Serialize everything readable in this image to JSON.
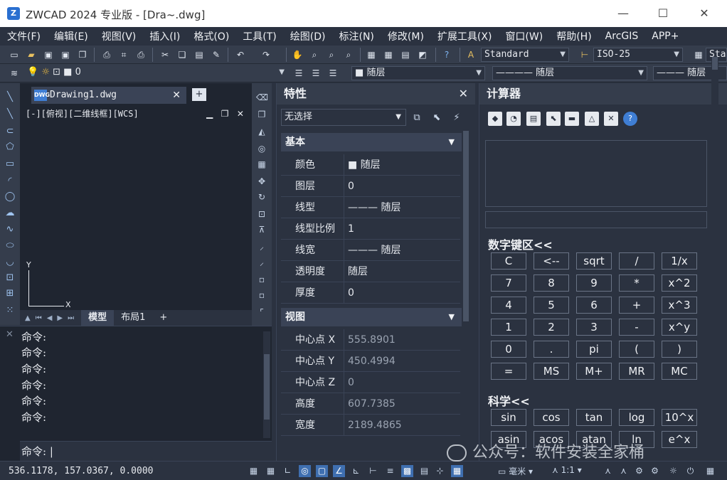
{
  "window": {
    "title": "ZWCAD 2024 专业版 - [Dra~.dwg]",
    "minimize": "—",
    "maximize": "☐",
    "close": "✕"
  },
  "menu": [
    "文件(F)",
    "编辑(E)",
    "视图(V)",
    "插入(I)",
    "格式(O)",
    "工具(T)",
    "绘图(D)",
    "标注(N)",
    "修改(M)",
    "扩展工具(X)",
    "窗口(W)",
    "帮助(H)",
    "ArcGIS",
    "APP+"
  ],
  "toolbar": {
    "text_style": "Standard",
    "dim_style": "ISO-25",
    "table_style": "Sta",
    "layer_current": "0",
    "color": "随层",
    "linetype": "———— 随层",
    "lineweight": "——— 随层"
  },
  "document": {
    "tab_name": "Drawing1.dwg",
    "dwg_badge": "DWG",
    "view_label": "[-][俯视][二维线框][WCS]",
    "axis_x": "X",
    "axis_y": "Y",
    "layout_tabs": [
      "模型",
      "布局1",
      "+"
    ]
  },
  "command": {
    "history": [
      "命令:",
      "命令:",
      "命令:",
      "命令:",
      "命令:",
      "命令:"
    ],
    "prompt": "命令:"
  },
  "properties": {
    "title": "特性",
    "selection": "无选择",
    "sections": {
      "basic": "基本",
      "view": "视图"
    },
    "basic_rows": [
      {
        "key": "颜色",
        "value": "随层"
      },
      {
        "key": "图层",
        "value": "0"
      },
      {
        "key": "线型",
        "value": "——— 随层"
      },
      {
        "key": "线型比例",
        "value": "1"
      },
      {
        "key": "线宽",
        "value": "——— 随层"
      },
      {
        "key": "透明度",
        "value": "随层"
      },
      {
        "key": "厚度",
        "value": "0"
      }
    ],
    "view_rows": [
      {
        "key": "中心点 X",
        "value": "555.8901"
      },
      {
        "key": "中心点 Y",
        "value": "450.4994"
      },
      {
        "key": "中心点 Z",
        "value": "0"
      },
      {
        "key": "高度",
        "value": "607.7385"
      },
      {
        "key": "宽度",
        "value": "2189.4865"
      }
    ]
  },
  "calculator": {
    "title": "计算器",
    "numpad_header": "数字键区<<",
    "science_header": "科学<<",
    "numpad": [
      [
        "C",
        "<--",
        "sqrt",
        "/",
        "1/x"
      ],
      [
        "7",
        "8",
        "9",
        "*",
        "x^2"
      ],
      [
        "4",
        "5",
        "6",
        "+",
        "x^3"
      ],
      [
        "1",
        "2",
        "3",
        "-",
        "x^y"
      ],
      [
        "0",
        ".",
        "pi",
        "(",
        ")"
      ],
      [
        "=",
        "MS",
        "M+",
        "MR",
        "MC"
      ]
    ],
    "science": [
      [
        "sin",
        "cos",
        "tan",
        "log",
        "10^x"
      ],
      [
        "asin",
        "acos",
        "atan",
        "ln",
        "e^x"
      ]
    ]
  },
  "status": {
    "coords": "536.1178, 157.0367, 0.0000",
    "unit": "毫米",
    "scale": "1:1"
  },
  "watermark": "公众号：软件安装全家桶"
}
